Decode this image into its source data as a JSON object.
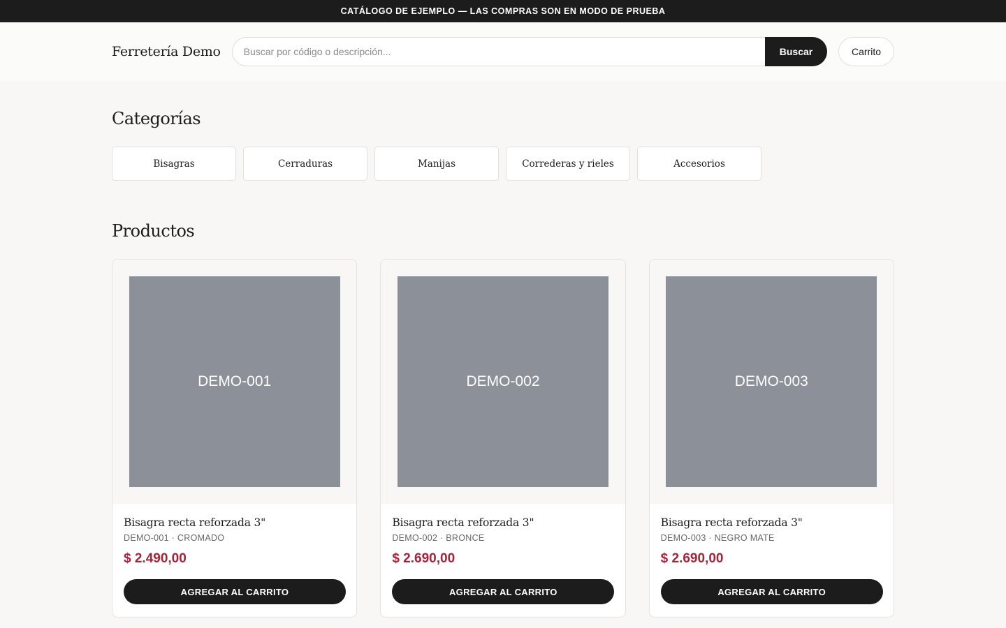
{
  "announcement": "CATÁLOGO DE EJEMPLO — LAS COMPRAS SON EN MODO DE PRUEBA",
  "header": {
    "brand": "Ferretería Demo",
    "search_placeholder": "Buscar por código o descripción...",
    "search_button": "Buscar",
    "cart_button": "Carrito"
  },
  "categories": {
    "title": "Categorías",
    "items": [
      {
        "label": "Bisagras"
      },
      {
        "label": "Cerraduras"
      },
      {
        "label": "Manijas"
      },
      {
        "label": "Correderas y rieles"
      },
      {
        "label": "Accesorios"
      }
    ]
  },
  "products": {
    "title": "Productos",
    "items": [
      {
        "image_label": "DEMO-001",
        "name": "Bisagra recta reforzada 3\"",
        "meta": "DEMO-001 · CROMADO",
        "price": "$ 2.490,00",
        "button": "AGREGAR AL CARRITO"
      },
      {
        "image_label": "DEMO-002",
        "name": "Bisagra recta reforzada 3\"",
        "meta": "DEMO-002 · BRONCE",
        "price": "$ 2.690,00",
        "button": "AGREGAR AL CARRITO"
      },
      {
        "image_label": "DEMO-003",
        "name": "Bisagra recta reforzada 3\"",
        "meta": "DEMO-003 · NEGRO MATE",
        "price": "$ 2.690,00",
        "button": "AGREGAR AL CARRITO"
      }
    ]
  },
  "colors": {
    "dark": "#1c1c1c",
    "price": "#a8233a",
    "placeholder_image": "#8c9199",
    "background": "#f8f7f5"
  }
}
